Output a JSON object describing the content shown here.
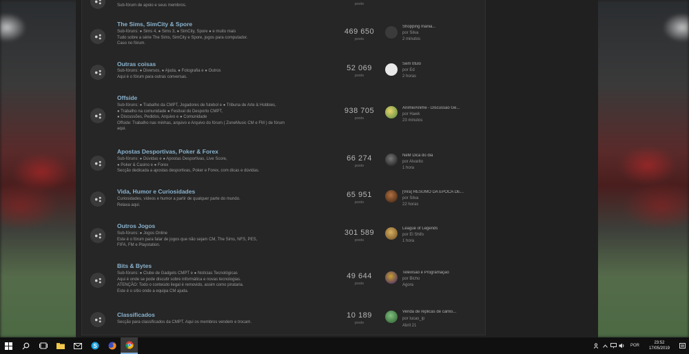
{
  "forums": [
    {
      "title": "Offside",
      "desc_lines": [
        "Sub-fóruns: ● Trabalho da CMPT, Jogadores de futebol e ● Tribuna de Arte & Hobbies,",
        "● Trabalho na comunidade ● Festival do Desporto CMPT,",
        "● Discussões, Pedidos, Arquivo e ● Comunidade",
        "Offside: Trabalho nas minhas, arquivo e Arquivo do fórum ( ZoneMusic CM e FM ) de fórum",
        "aqui."
      ],
      "count": "938 705",
      "count_label": "posts",
      "last_title": "Anime/Anime - Discussão Ge...",
      "last_by": "por Hawk",
      "last_time": "23 minutos"
    },
    {
      "title": "Apostas Desportivas, Poker & Forex",
      "desc_lines": [
        "Sub-fóruns: ● Dúvidas e ● Apostas Desportivas, Live Score,",
        "● Poker & Casino e ● Forex",
        "Secção dedicada a apostas desportivas, Poker e Forex, com dicas e dúvidas."
      ],
      "count": "66 274",
      "count_label": "posts",
      "last_title": "NeM Dica do dia",
      "last_by": "por Alvarito",
      "last_time": "1 hora"
    },
    {
      "title": "Vida, Humor e Curiosidades",
      "desc_lines": [
        "Curiosidades, vídeos e humor a partir de qualquer parte do mundo.",
        "Relaxa aqui."
      ],
      "count": "65 951",
      "count_label": "posts",
      "last_title": "[Vira] RESUMO DA ÉPOCA DE...",
      "last_by": "por Silva",
      "last_time": "22 horas"
    },
    {
      "title": "Outros Jogos",
      "desc_lines": [
        "Sub-fóruns: ● Jogos Online",
        "Este é o fórum para falar de jogos que não sejam CM, The Sims, NFS, PES,",
        "FIFA, FM e Playstation."
      ],
      "count": "301 589",
      "count_label": "posts",
      "last_title": "League of Legends",
      "last_by": "por El Shifo",
      "last_time": "1 hora"
    },
    {
      "title": "Bits & Bytes",
      "desc_lines": [
        "Sub-fóruns: ● Clube de Gadgets CMPT e ● Notícias Tecnológicas",
        "Aqui é onde se pode discutir sobre informática e novas tecnologias.",
        "ATENÇÃO: Todo o conteúdo ilegal é removido, assim como pirataria.",
        "Este é o sítio onde a equipa CM ajuda."
      ],
      "count": "49 644",
      "count_label": "posts",
      "last_title": "Televisão e Programação",
      "last_by": "por Bicho",
      "last_time": "Agora"
    },
    {
      "title": "Classificados",
      "desc_lines": [
        "Secção para classificados da CMPT. Aqui os membros vendem e trocam."
      ],
      "count": "10 189",
      "count_label": "posts",
      "last_title": "Venda de réplicas de camis...",
      "last_by": "por lucas_ip",
      "last_time": "Abril 21"
    }
  ],
  "top_partial": {
    "desc_line": "Sub-fórum de apoio e seus membros.",
    "count_label": "posts"
  },
  "row2": {
    "title": "The Sims, SimCity & Spore",
    "desc_lines": [
      "Sub-fóruns: ● Sims 4, ● Sims 3, ● SimCity, Spore ● e muito mais",
      "Tudo sobre a série The Sims, SimCity e Spore, jogos para computador.",
      "Caso no fórum."
    ],
    "count": "469 650",
    "count_label": "posts",
    "last_title": "Shopping mania...",
    "last_by": "por Silva",
    "last_time": "2 minutos"
  },
  "row3": {
    "title": "Outras coisas",
    "desc_lines": [
      "Sub-fóruns: ● Diversos, ● Ajuda, ● Fotografia e ● Outros",
      "Aqui é o fórum para outras conversas."
    ],
    "count": "52 069",
    "count_label": "posts",
    "last_title": "Sem título",
    "last_by": "por Ed",
    "last_time": "2 horas"
  },
  "taskbar": {
    "apps": [
      "start-icon",
      "search-icon",
      "task-view-icon",
      "file-explorer-icon",
      "mail-icon",
      "skype-icon",
      "firefox-icon",
      "chrome-icon"
    ],
    "lang": "POR",
    "time": "23:52",
    "date": "17/05/2019"
  },
  "colors": {
    "accent_title": "#8ab4d0",
    "panel": "#262626",
    "taskbar": "#101010"
  }
}
